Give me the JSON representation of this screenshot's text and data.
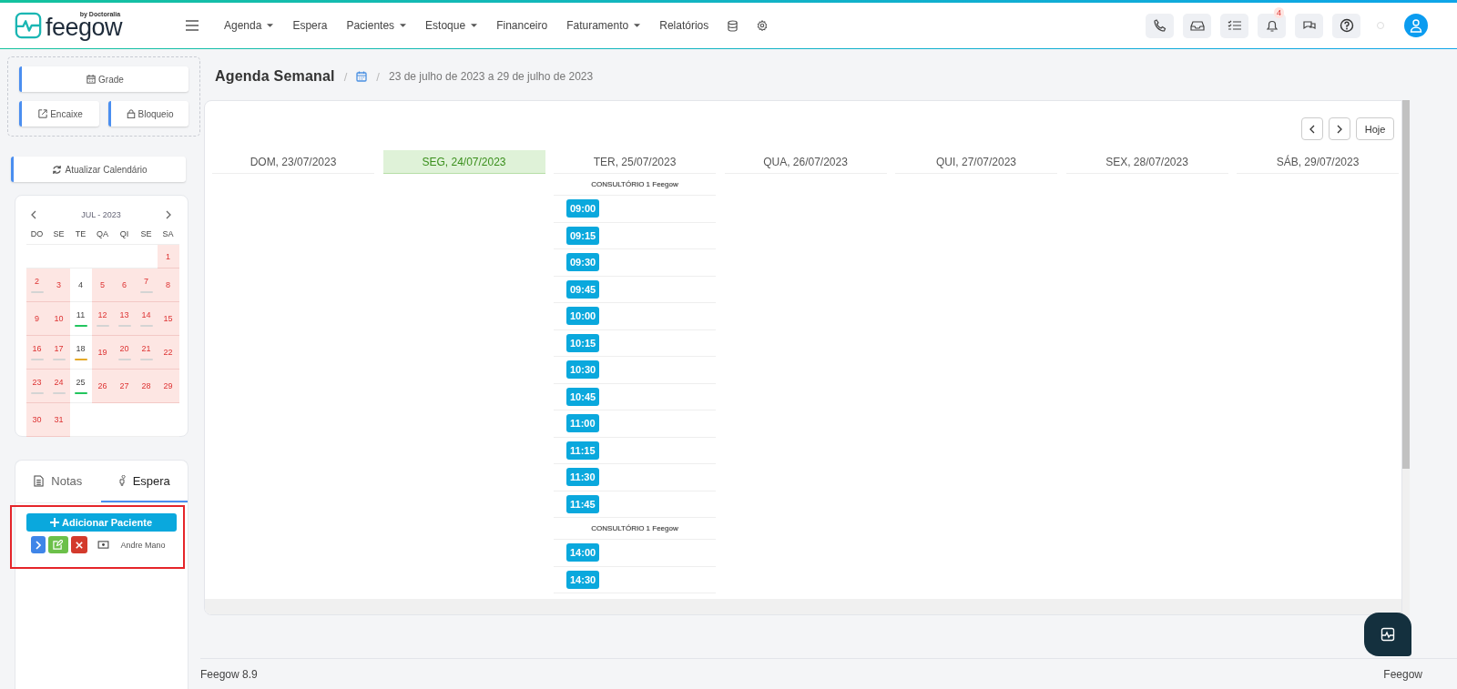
{
  "topbar": {
    "logo": {
      "tagline": "by Doctoralia",
      "name": "feegow"
    },
    "menu": [
      {
        "label": "Agenda",
        "dropdown": true
      },
      {
        "label": "Espera",
        "dropdown": false
      },
      {
        "label": "Pacientes",
        "dropdown": true
      },
      {
        "label": "Estoque",
        "dropdown": true
      },
      {
        "label": "Financeiro",
        "dropdown": false
      },
      {
        "label": "Faturamento",
        "dropdown": true
      },
      {
        "label": "Relatórios",
        "dropdown": false
      }
    ],
    "notification_count": "4"
  },
  "sidebar": {
    "actions": [
      "Grade",
      "Encaixe",
      "Bloqueio"
    ],
    "refresh": "Atualizar Calendário",
    "mini_calendar": {
      "month": "JUL - 2023",
      "weekdays": [
        "DO",
        "SE",
        "TE",
        "QA",
        "QI",
        "SE",
        "SA"
      ],
      "weeks": [
        [
          {
            "kind": "empty"
          },
          {
            "kind": "empty"
          },
          {
            "kind": "empty"
          },
          {
            "kind": "empty"
          },
          {
            "kind": "empty"
          },
          {
            "kind": "empty"
          },
          {
            "kind": "blocked",
            "day": "1"
          }
        ],
        [
          {
            "kind": "blocked",
            "day": "2",
            "color": "#d4d4d4"
          },
          {
            "kind": "blocked",
            "day": "3"
          },
          {
            "kind": "open",
            "day": "4"
          },
          {
            "kind": "blocked",
            "day": "5"
          },
          {
            "kind": "blocked",
            "day": "6"
          },
          {
            "kind": "blocked",
            "day": "7",
            "color": "#d4d4d4"
          },
          {
            "kind": "blocked",
            "day": "8"
          }
        ],
        [
          {
            "kind": "blocked",
            "day": "9"
          },
          {
            "kind": "blocked",
            "day": "10"
          },
          {
            "kind": "open",
            "day": "11",
            "color": "#22c55e"
          },
          {
            "kind": "blocked",
            "day": "12",
            "color": "#d4d4d4"
          },
          {
            "kind": "blocked",
            "day": "13",
            "color": "#d4d4d4"
          },
          {
            "kind": "blocked",
            "day": "14",
            "color": "#d4d4d4"
          },
          {
            "kind": "blocked",
            "day": "15"
          }
        ],
        [
          {
            "kind": "blocked",
            "day": "16",
            "color": "#d4d4d4"
          },
          {
            "kind": "blocked",
            "day": "17",
            "color": "#d4d4d4"
          },
          {
            "kind": "open",
            "day": "18",
            "color": "#e5a928"
          },
          {
            "kind": "blocked",
            "day": "19"
          },
          {
            "kind": "blocked",
            "day": "20",
            "color": "#d4d4d4"
          },
          {
            "kind": "blocked",
            "day": "21",
            "color": "#d4d4d4"
          },
          {
            "kind": "blocked",
            "day": "22"
          }
        ],
        [
          {
            "kind": "blocked",
            "day": "23",
            "color": "#d4d4d4"
          },
          {
            "kind": "blocked",
            "day": "24",
            "color": "#d4d4d4"
          },
          {
            "kind": "open",
            "day": "25",
            "color": "#22c55e"
          },
          {
            "kind": "blocked",
            "day": "26"
          },
          {
            "kind": "blocked",
            "day": "27"
          },
          {
            "kind": "blocked",
            "day": "28"
          },
          {
            "kind": "blocked",
            "day": "29"
          }
        ],
        [
          {
            "kind": "blocked",
            "day": "30"
          },
          {
            "kind": "blocked",
            "day": "31"
          },
          {
            "kind": "empty"
          },
          {
            "kind": "empty"
          },
          {
            "kind": "empty"
          },
          {
            "kind": "empty"
          },
          {
            "kind": "empty"
          }
        ]
      ]
    },
    "tabs": [
      {
        "label": "Notas",
        "selected": false
      },
      {
        "label": "Espera",
        "selected": true
      }
    ],
    "add_button": "Adicionar Paciente",
    "waiting": [
      {
        "name": "Andre Mano"
      }
    ]
  },
  "main": {
    "title": "Agenda Semanal",
    "separators": [
      "/",
      "/"
    ],
    "range": "23 de julho de 2023 a 29 de julho de 2023",
    "today_button": "Hoje",
    "days": [
      {
        "label": "DOM, 23/07/2023",
        "selected": false
      },
      {
        "label": "SEG, 24/07/2023",
        "selected": true
      },
      {
        "label": "TER, 25/07/2023",
        "selected": false,
        "entries": [
          {
            "kind": "room",
            "label": "CONSULTÓRIO 1 Feegow"
          },
          {
            "kind": "slot",
            "label": "09:00"
          },
          {
            "kind": "slot",
            "label": "09:15"
          },
          {
            "kind": "slot",
            "label": "09:30"
          },
          {
            "kind": "slot",
            "label": "09:45"
          },
          {
            "kind": "slot",
            "label": "10:00"
          },
          {
            "kind": "slot",
            "label": "10:15"
          },
          {
            "kind": "slot",
            "label": "10:30"
          },
          {
            "kind": "slot",
            "label": "10:45"
          },
          {
            "kind": "slot",
            "label": "11:00"
          },
          {
            "kind": "slot",
            "label": "11:15"
          },
          {
            "kind": "slot",
            "label": "11:30"
          },
          {
            "kind": "slot",
            "label": "11:45"
          },
          {
            "kind": "room",
            "label": "CONSULTÓRIO 1 Feegow"
          },
          {
            "kind": "slot",
            "label": "14:00"
          },
          {
            "kind": "slot",
            "label": "14:30"
          }
        ]
      },
      {
        "label": "QUA, 26/07/2023",
        "selected": false
      },
      {
        "label": "QUI, 27/07/2023",
        "selected": false
      },
      {
        "label": "SEX, 28/07/2023",
        "selected": false
      },
      {
        "label": "SÁB, 29/07/2023",
        "selected": false
      }
    ]
  },
  "footer": {
    "version": "Feegow 8.9",
    "brand": "Feegow"
  }
}
